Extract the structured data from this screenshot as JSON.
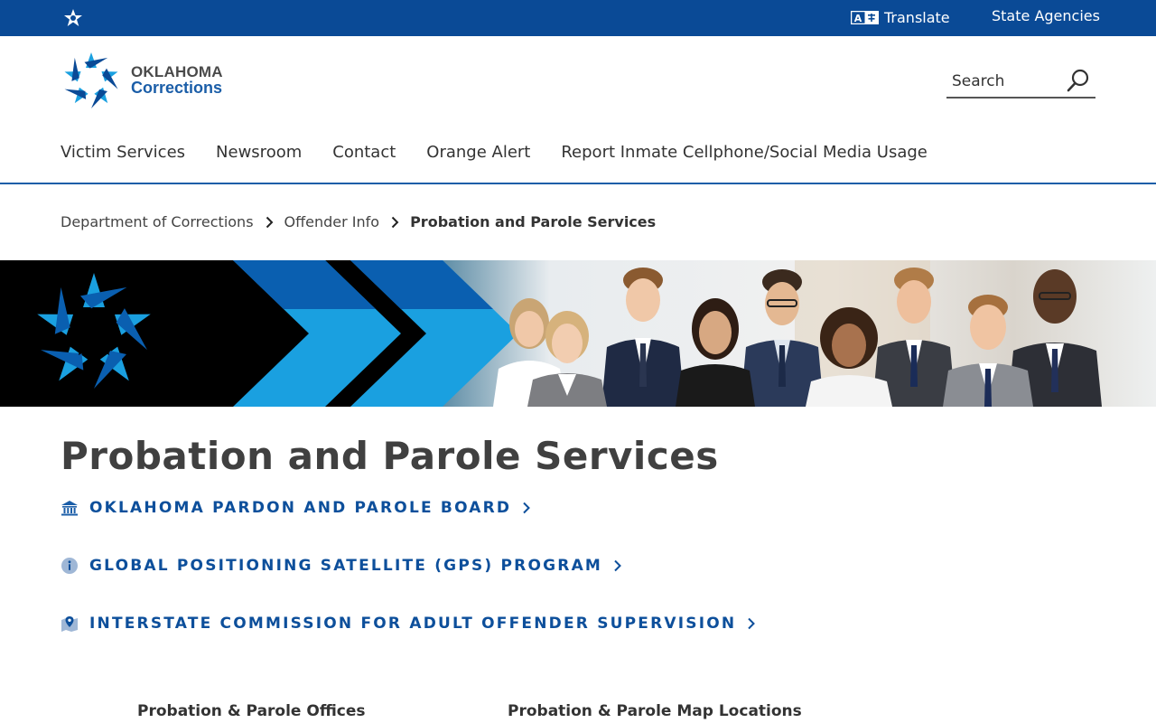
{
  "topbar": {
    "home_icon": "oklahoma-star-icon",
    "translate_label": "Translate",
    "translate_icon": "translate-icon",
    "state_agencies_label": "State Agencies"
  },
  "logo": {
    "line1": "OKLAHOMA",
    "line2": "Corrections",
    "icon": "oklahoma-star-logo"
  },
  "search": {
    "placeholder": "Search",
    "icon": "search-icon"
  },
  "nav": {
    "items": [
      {
        "label": "Victim Services"
      },
      {
        "label": "Newsroom"
      },
      {
        "label": "Contact"
      },
      {
        "label": "Orange Alert"
      },
      {
        "label": "Report Inmate Cellphone/Social Media Usage"
      }
    ]
  },
  "breadcrumb": {
    "items": [
      {
        "label": "Department of Corrections"
      },
      {
        "label": "Offender Info"
      },
      {
        "label": "Probation and Parole Services"
      }
    ]
  },
  "page": {
    "title": "Probation and Parole Services"
  },
  "links": [
    {
      "label": "OKLAHOMA PARDON AND PAROLE BOARD",
      "icon": "courthouse-icon"
    },
    {
      "label": "GLOBAL POSITIONING SATELLITE (GPS) PROGRAM",
      "icon": "info-icon"
    },
    {
      "label": "INTERSTATE COMMISSION FOR ADULT OFFENDER SUPERVISION",
      "icon": "map-pin-icon"
    }
  ],
  "tiles": [
    {
      "label": "Probation & Parole Offices"
    },
    {
      "label": "Probation & Parole Map Locations"
    }
  ],
  "colors": {
    "brand_blue": "#0a4a96",
    "link_blue": "#0d4f9b",
    "accent_light_blue": "#1aa0e0"
  }
}
